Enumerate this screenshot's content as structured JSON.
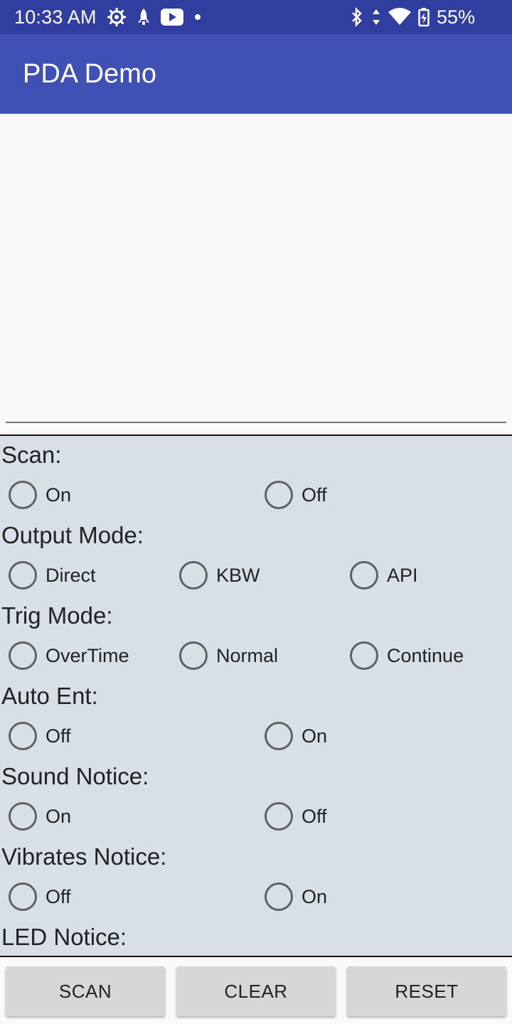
{
  "status_bar": {
    "time": "10:33 AM",
    "left_icons": [
      "settings-gear-icon",
      "rocket-icon",
      "youtube-icon",
      "dot-icon"
    ],
    "right_icons": [
      "bluetooth-icon",
      "data-arrows-icon",
      "wifi-icon",
      "battery-charging-icon"
    ],
    "battery": "55%"
  },
  "app_bar": {
    "title": "PDA Demo",
    "color": "#3f51b5"
  },
  "settings": {
    "scan": {
      "label": "Scan:",
      "options": [
        "On",
        "Off"
      ]
    },
    "output_mode": {
      "label": "Output Mode:",
      "options": [
        "Direct",
        "KBW",
        "API"
      ]
    },
    "trig_mode": {
      "label": "Trig Mode:",
      "options": [
        "OverTime",
        "Normal",
        "Continue"
      ]
    },
    "auto_ent": {
      "label": "Auto Ent:",
      "options": [
        "Off",
        "On"
      ]
    },
    "sound_notice": {
      "label": "Sound Notice:",
      "options": [
        "On",
        "Off"
      ]
    },
    "vibrates_notice": {
      "label": "Vibrates Notice:",
      "options": [
        "Off",
        "On"
      ]
    },
    "led_notice": {
      "label": "LED Notice:"
    }
  },
  "buttons": {
    "scan": "SCAN",
    "clear": "CLEAR",
    "reset": "RESET"
  }
}
